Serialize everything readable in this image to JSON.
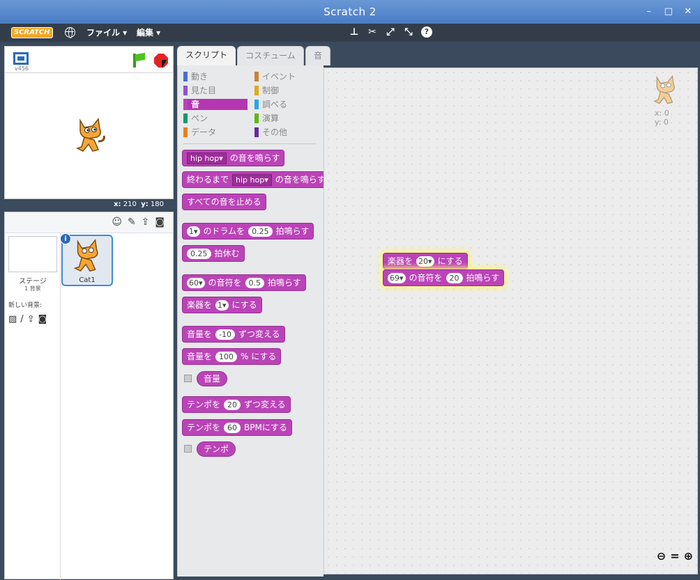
{
  "window": {
    "title": "Scratch 2",
    "buttons": [
      "–",
      "□",
      "✕"
    ]
  },
  "menubar": {
    "logo": "SCRATCH",
    "file": "ファイル ▾",
    "edit": "編集 ▾"
  },
  "stage": {
    "version": "v456",
    "coords": {
      "x_label": "x:",
      "x": "210",
      "y_label": "y:",
      "y": "180"
    }
  },
  "sprites": {
    "stage_label": "ステージ",
    "stage_count": "1 背景",
    "new_backdrop": "新しい背景:",
    "sprite_name": "Cat1"
  },
  "tabs": {
    "scripts": "スクリプト",
    "costumes": "コスチューム",
    "sounds": "音"
  },
  "categories": {
    "left": [
      "動き",
      "見た目",
      "音",
      "ペン",
      "データ"
    ],
    "right": [
      "イベント",
      "制御",
      "調べる",
      "演算",
      "その他"
    ],
    "colors": {
      "motion": "#4a6cd4",
      "looks": "#8a55d7",
      "sound": "#bb43b8",
      "pen": "#0e9a6c",
      "data": "#ee7d16",
      "events": "#c88330",
      "control": "#e1a91a",
      "sensing": "#2ca5e2",
      "operators": "#5cb712",
      "more": "#632d99"
    }
  },
  "blocks": {
    "play_sound": {
      "dropdown": "hip hop",
      "text": "の音を鳴らす"
    },
    "play_sound_until": {
      "prefix": "終わるまで",
      "dropdown": "hip hop",
      "text": "の音を鳴らす"
    },
    "stop_all": "すべての音を止める",
    "play_drum": {
      "dropdown": "1",
      "mid": "のドラムを",
      "value": "0.25",
      "text": "拍鳴らす"
    },
    "rest": {
      "value": "0.25",
      "text": "拍休む"
    },
    "play_note": {
      "dropdown": "60",
      "mid": "の音符を",
      "value": "0.5",
      "text": "拍鳴らす"
    },
    "set_instrument": {
      "prefix": "楽器を",
      "dropdown": "1",
      "text": "にする"
    },
    "change_volume": {
      "prefix": "音量を",
      "value": "-10",
      "text": "ずつ変える"
    },
    "set_volume": {
      "prefix": "音量を",
      "value": "100",
      "text": "% にする"
    },
    "volume_reporter": "音量",
    "change_tempo": {
      "prefix": "テンポを",
      "value": "20",
      "text": "ずつ変える"
    },
    "set_tempo": {
      "prefix": "テンポを",
      "value": "60",
      "text": "BPMにする"
    },
    "tempo_reporter": "テンポ"
  },
  "script": {
    "block1": {
      "prefix": "楽器を",
      "dropdown": "20",
      "text": "にする"
    },
    "block2": {
      "dropdown": "69",
      "mid": "の音符を",
      "value": "20",
      "text": "拍鳴らす"
    },
    "sprite_x": "x: 0",
    "sprite_y": "y: 0"
  }
}
